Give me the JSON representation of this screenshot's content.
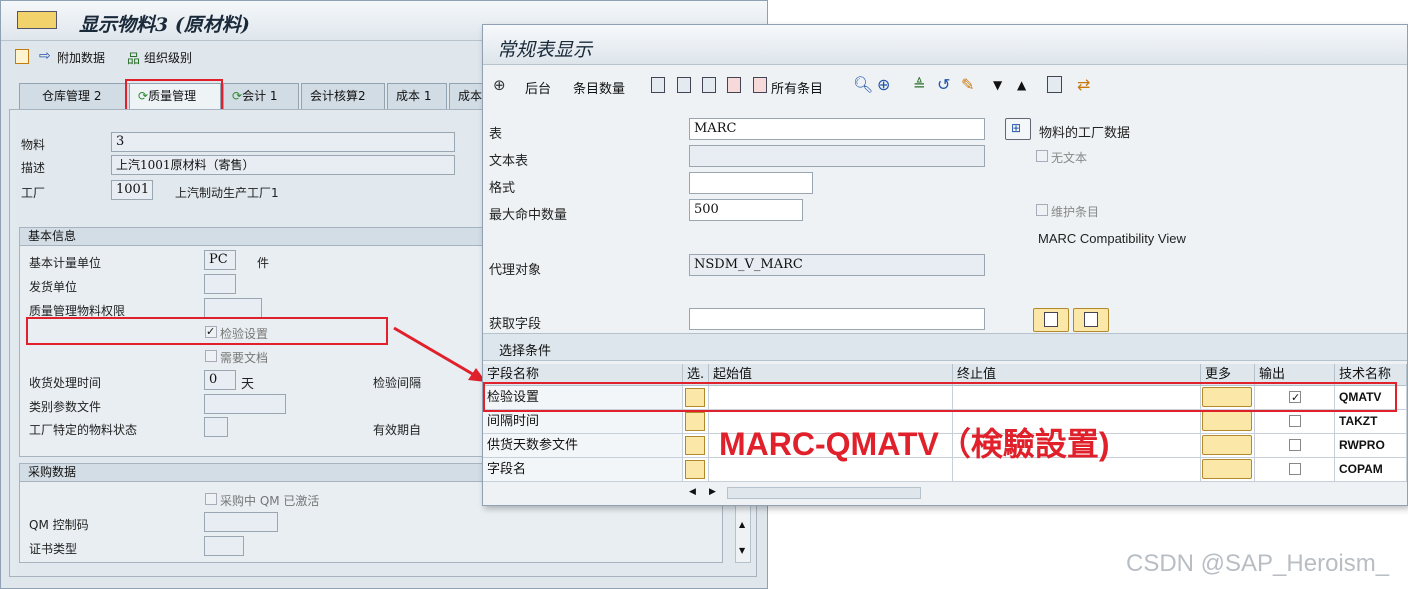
{
  "left_window": {
    "title": "显示物料3 (原材料)",
    "toolbar": {
      "additional_data": "附加数据",
      "org_levels": "组织级别"
    },
    "tabs": [
      "仓库管理 2",
      "质量管理",
      "会计 1",
      "会计核算2",
      "成本 1",
      "成本"
    ],
    "header": {
      "material_label": "物料",
      "material_value": "3",
      "desc_label": "描述",
      "desc_value": "上汽1001原材料（寄售）",
      "plant_label": "工厂",
      "plant_value": "1001",
      "plant_name": "上汽制动生产工厂1"
    },
    "basic": {
      "title": "基本信息",
      "base_uom_label": "基本计量单位",
      "base_uom_value": "PC",
      "base_uom_unit": "件",
      "issue_unit_label": "发货单位",
      "qm_auth_label": "质量管理物料权限",
      "inspection_setup_label": "检验设置",
      "docs_required_label": "需要文档",
      "gr_time_label": "收货处理时间",
      "gr_time_value": "0",
      "gr_time_unit": "天",
      "inspection_interval_label": "检验间隔",
      "catalog_profile_label": "类别参数文件",
      "plant_status_label": "工厂特定的物料状态",
      "valid_from_label": "有效期自"
    },
    "purchasing": {
      "title": "采购数据",
      "qm_active_label": "采购中 QM 已激活",
      "qm_control_key_label": "QM 控制码",
      "cert_type_label": "证书类型"
    }
  },
  "right_window": {
    "title": "常规表显示",
    "toolbar": {
      "background": "后台",
      "entry_count": "条目数量",
      "all_entries": "所有条目"
    },
    "form": {
      "table_label": "表",
      "table_value": "MARC",
      "text_table_label": "文本表",
      "format_label": "格式",
      "max_hits_label": "最大命中数量",
      "max_hits_value": "500",
      "proxy_label": "代理对象",
      "proxy_value": "NSDM_V_MARC",
      "fetch_fields_label": "获取字段",
      "plant_data_button": "物料的工厂数据",
      "no_text_label": "无文本",
      "maintain_entries_label": "维护条目",
      "compat_view": "MARC Compatibility View"
    },
    "selection": {
      "title": "选择条件",
      "columns": {
        "field": "字段名称",
        "sel": "选.",
        "from": "起始值",
        "to": "终止值",
        "more": "更多",
        "output": "输出",
        "tech": "技术名称"
      },
      "rows": [
        {
          "field": "检验设置",
          "output": true,
          "tech": "QMATV"
        },
        {
          "field": "间隔时间",
          "output": false,
          "tech": "TAKZT"
        },
        {
          "field": "供货天数参文件",
          "output": false,
          "tech": "RWPRO"
        },
        {
          "field": "字段名",
          "output": false,
          "tech": "COPAM"
        }
      ]
    }
  },
  "annotation": "MARC-QMATV（検驗設置)",
  "watermark": "CSDN @SAP_Heroism_",
  "colors": {
    "highlight": "#e0202a",
    "window_bg": "#dfe6ec",
    "selection_btn": "#fbe7a7"
  }
}
